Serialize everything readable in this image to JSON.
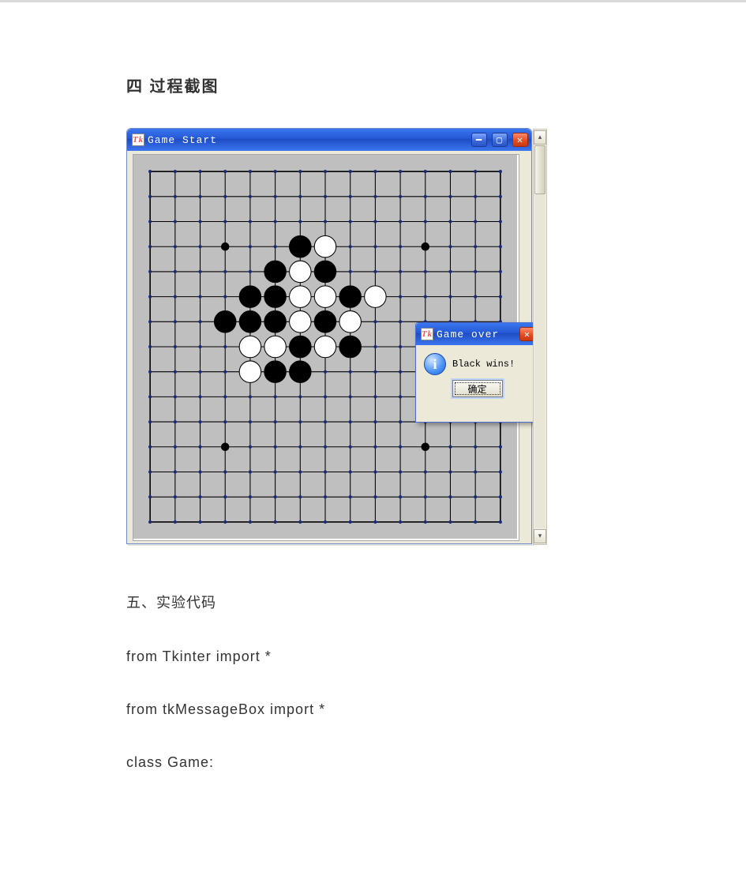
{
  "headings": {
    "h4": "四 过程截图",
    "h5": "五、实验代码"
  },
  "code": {
    "line1": "from Tkinter import *",
    "line2": "from tkMessageBox import *",
    "line3": "class Game:"
  },
  "win": {
    "tk_icon_text": "Tk",
    "title": "Game Start",
    "min_glyph": "━",
    "max_glyph": "▢",
    "close_glyph": "✕"
  },
  "dialog": {
    "title": "Game over",
    "close_glyph": "✕",
    "info_glyph": "i",
    "message": "Black wins!",
    "ok_label": "确定"
  },
  "scroll": {
    "up": "▴",
    "down": "▾"
  },
  "board": {
    "size": 15,
    "cell": 30,
    "margin": 20,
    "star_points": [
      [
        3,
        3
      ],
      [
        3,
        11
      ],
      [
        11,
        3
      ],
      [
        11,
        11
      ],
      [
        7,
        7
      ]
    ],
    "black": [
      [
        6,
        3
      ],
      [
        5,
        4
      ],
      [
        7,
        4
      ],
      [
        4,
        5
      ],
      [
        5,
        5
      ],
      [
        8,
        5
      ],
      [
        3,
        6
      ],
      [
        4,
        6
      ],
      [
        5,
        6
      ],
      [
        7,
        6
      ],
      [
        6,
        7
      ],
      [
        8,
        7
      ],
      [
        5,
        8
      ],
      [
        6,
        8
      ]
    ],
    "white": [
      [
        7,
        3
      ],
      [
        6,
        4
      ],
      [
        6,
        5
      ],
      [
        7,
        5
      ],
      [
        9,
        5
      ],
      [
        6,
        6
      ],
      [
        8,
        6
      ],
      [
        4,
        7
      ],
      [
        5,
        7
      ],
      [
        7,
        7
      ],
      [
        4,
        8
      ]
    ]
  }
}
